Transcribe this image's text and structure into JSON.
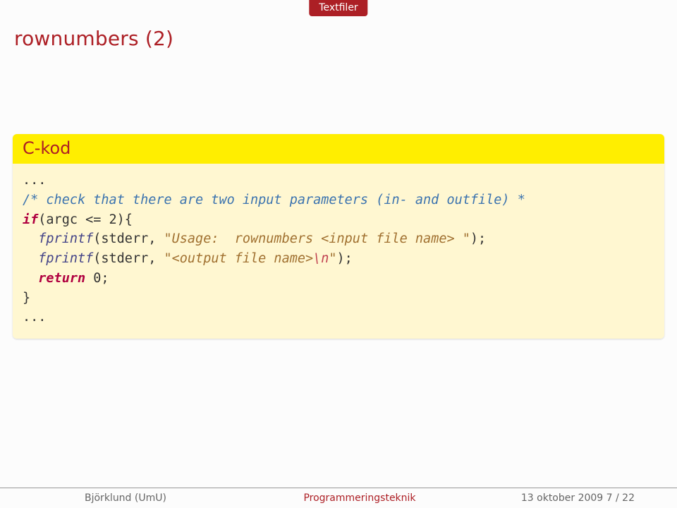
{
  "section_tab": "Textfiler",
  "slide_title": "rownumbers (2)",
  "block_title": "C-kod",
  "code": {
    "l1": "...",
    "l2_a": "/* check that there are two input parameters (in- and outfile) *",
    "l3_kw": "if",
    "l3_rest": "(argc <= 2){",
    "l4_fn": "fprintf",
    "l4_mid": "(stderr, ",
    "l4_str": "\"Usage:  rownumbers <input file name> \"",
    "l4_end": ");",
    "l5_fn": "fprintf",
    "l5_mid": "(stderr, ",
    "l5_str_a": "\"<output file name>",
    "l5_esc": "\\n",
    "l5_str_b": "\"",
    "l5_end": ");",
    "l6_kw": "return",
    "l6_rest": " 0;",
    "l7": "}",
    "l8": "..."
  },
  "footer": {
    "left": "Björklund (UmU)",
    "center": "Programmeringsteknik",
    "right": "13 oktober 2009    7 / 22"
  }
}
